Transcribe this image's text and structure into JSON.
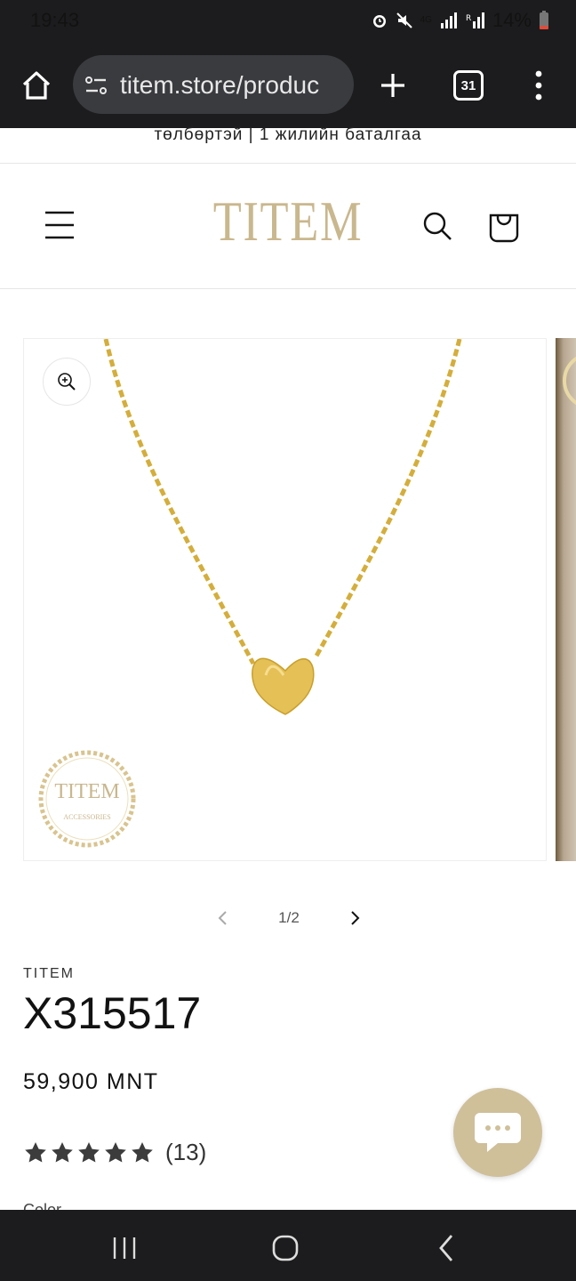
{
  "status_bar": {
    "time": "19:43",
    "battery": "14%"
  },
  "browser": {
    "url": "titem.store/produc",
    "tab_count": "31"
  },
  "promo": {
    "text": "төлбөртэй | 1 жилийн баталгаа"
  },
  "header": {
    "logo": "TITEM"
  },
  "gallery": {
    "watermark_brand": "TITEM",
    "watermark_sub": "ACCESSORIES",
    "pager_text": "1/2"
  },
  "product": {
    "vendor": "TITEM",
    "title": "X315517",
    "price": "59,900 MNT",
    "rating_stars": 5,
    "rating_count": "(13)",
    "option_label": "Color"
  },
  "colors": {
    "brand_gold": "#c9b78e",
    "chat_bg": "#cfc09a",
    "chrome_dark": "#1c1c1e"
  }
}
